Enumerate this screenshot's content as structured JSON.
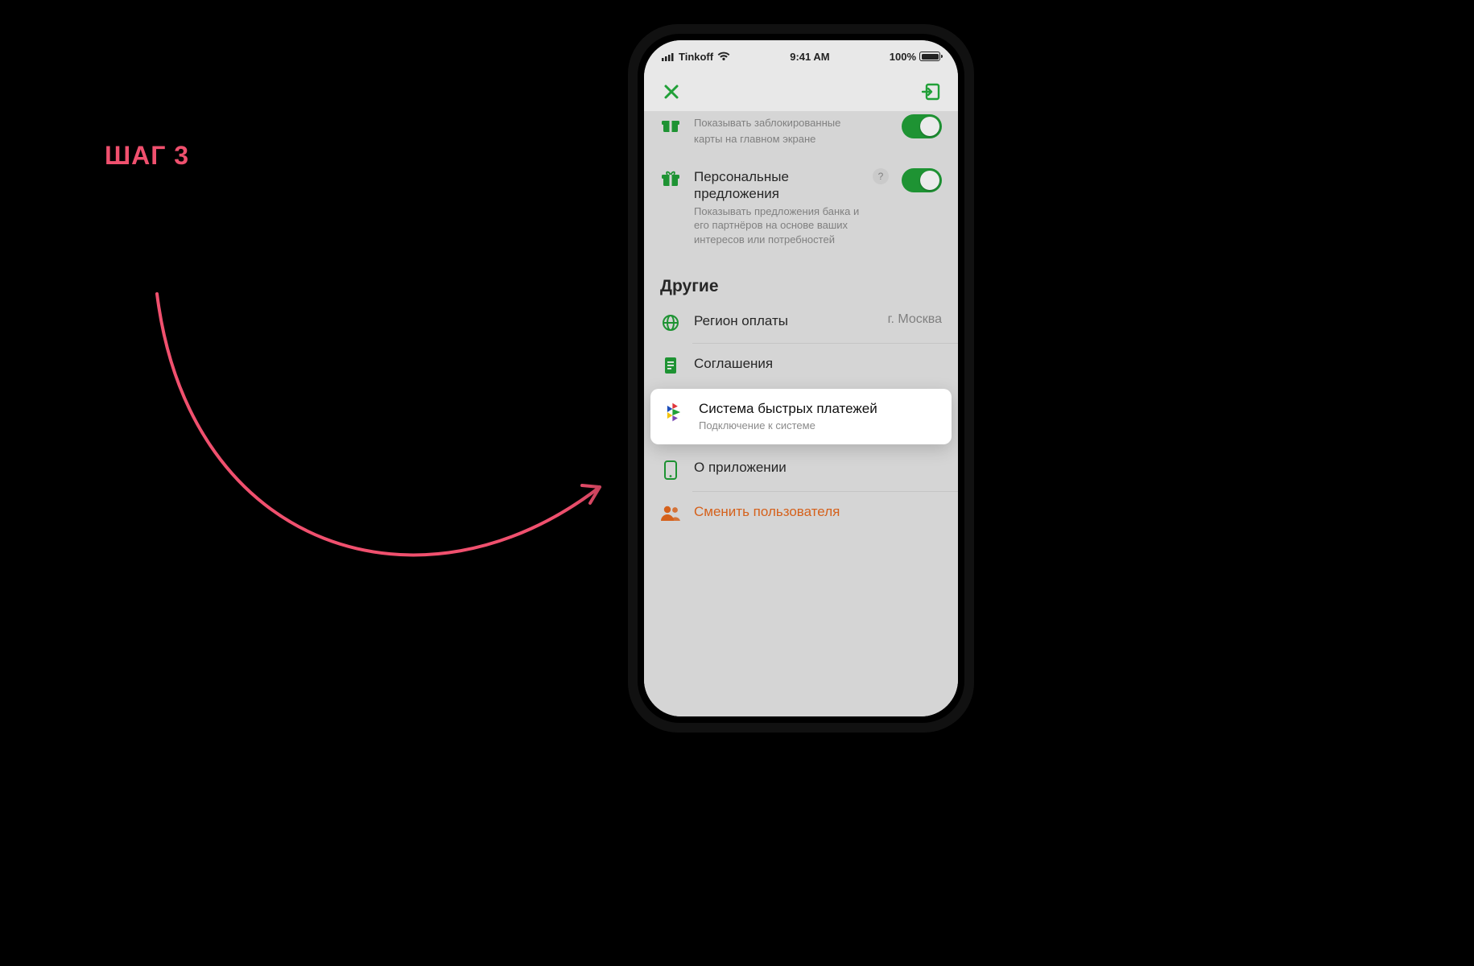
{
  "step": {
    "label": "ШАГ 3"
  },
  "status": {
    "carrier": "Tinkoff",
    "time": "9:41 AM",
    "battery": "100%"
  },
  "nav": {
    "close_label": "Закрыть",
    "exit_label": "Выход"
  },
  "partial_row": {
    "title": "Показывать заблокированные",
    "subtitle": "карты на главном экране"
  },
  "offers": {
    "title": "Персональные предложения",
    "subtitle": "Показывать предложения банка и его партнёров на основе ваших интересов или потребностей",
    "help": "?"
  },
  "section_other": "Другие",
  "rows": {
    "region": {
      "label": "Регион оплаты",
      "value": "г. Москва"
    },
    "agreements": {
      "label": "Соглашения"
    },
    "sbp": {
      "label": "Система быстрых платежей",
      "sub": "Подключение к системе"
    },
    "about": {
      "label": "О приложении"
    },
    "change_user": {
      "label": "Сменить пользователя"
    }
  },
  "colors": {
    "accent_green": "#21a038",
    "accent_orange": "#e86a1f",
    "arrow": "#f0506e"
  }
}
